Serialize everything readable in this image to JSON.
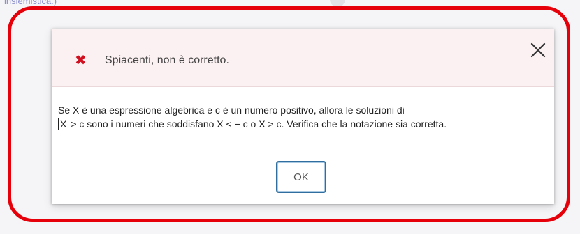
{
  "background": {
    "partial_text": "insiemistica.)"
  },
  "dialog": {
    "title": "Spiacenti, non è corretto.",
    "error_icon": "x-mark-icon",
    "close_icon": "close-icon",
    "message": {
      "part1": "Se X è una espressione algebrica e c è un numero positivo, allora le soluzioni di",
      "abs_variable": "X",
      "part2": "> c sono i numeri che soddisfano X < − c o X > c. Verifica che la notazione sia corretta."
    },
    "ok_label": "OK"
  },
  "colors": {
    "highlight_border": "#e6000a",
    "error_icon": "#d01020",
    "header_background": "#fbf1f2",
    "ok_border": "#2f6e9f"
  }
}
